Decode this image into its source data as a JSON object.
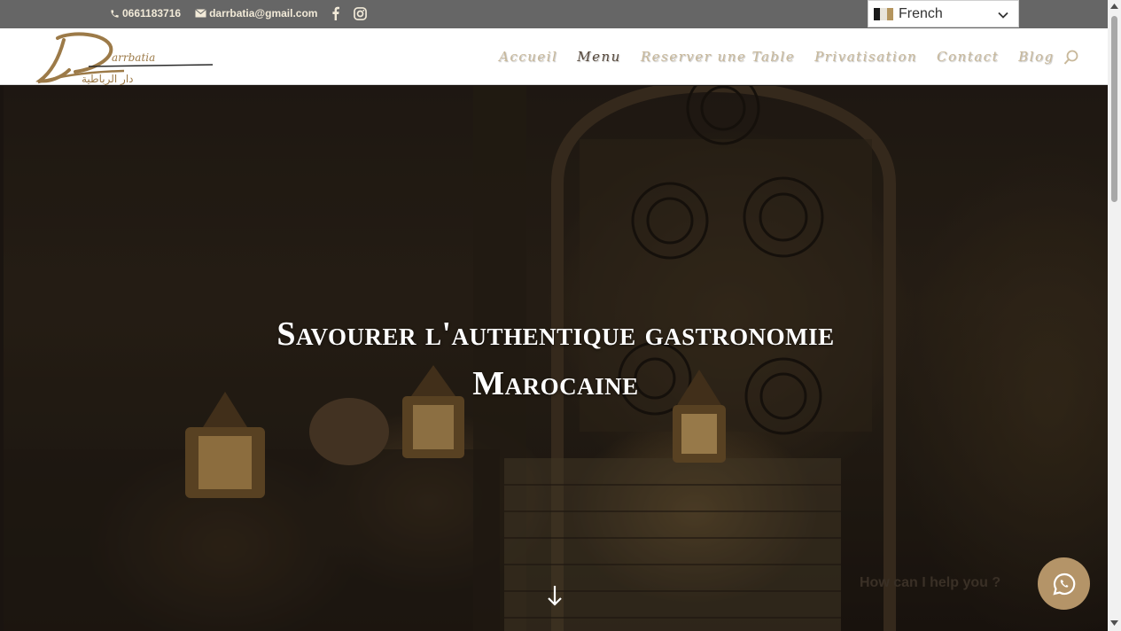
{
  "topbar": {
    "phone": "0661183716",
    "email": "darrbatia@gmail.com",
    "social": [
      "facebook-icon",
      "instagram-icon"
    ]
  },
  "language": {
    "selected": "French"
  },
  "nav": {
    "items": [
      "Accueil",
      "Menu",
      "Reserver une Table",
      "Privatisation",
      "Contact",
      "Blog"
    ],
    "active": "Menu"
  },
  "hero": {
    "title_line1": "Savourer l'authentique gastronomie",
    "title_line2": "Marocaine"
  },
  "chat": {
    "prompt": "How can I help you ?"
  },
  "colors": {
    "accent": "#b49468",
    "topbar": "#666666",
    "nav_inactive": "#c8b89a",
    "nav_active": "#55473a"
  }
}
